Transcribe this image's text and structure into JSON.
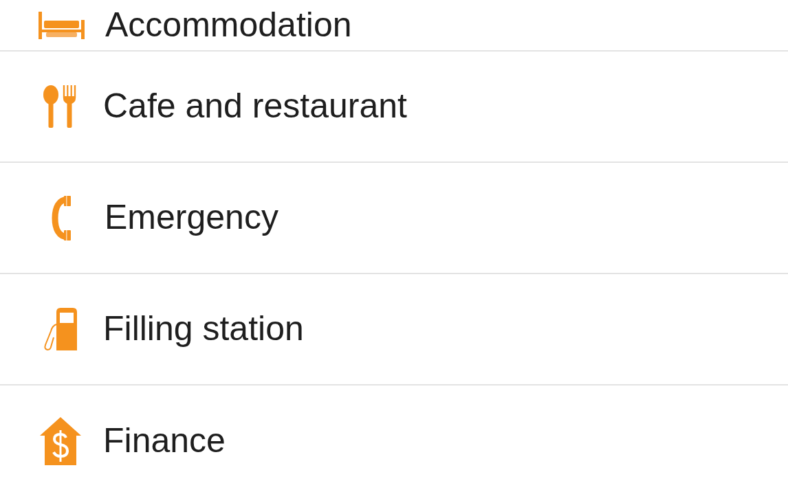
{
  "categories": [
    {
      "label": "Accommodation"
    },
    {
      "label": "Cafe and restaurant"
    },
    {
      "label": "Emergency"
    },
    {
      "label": "Filling station"
    },
    {
      "label": "Finance"
    }
  ]
}
